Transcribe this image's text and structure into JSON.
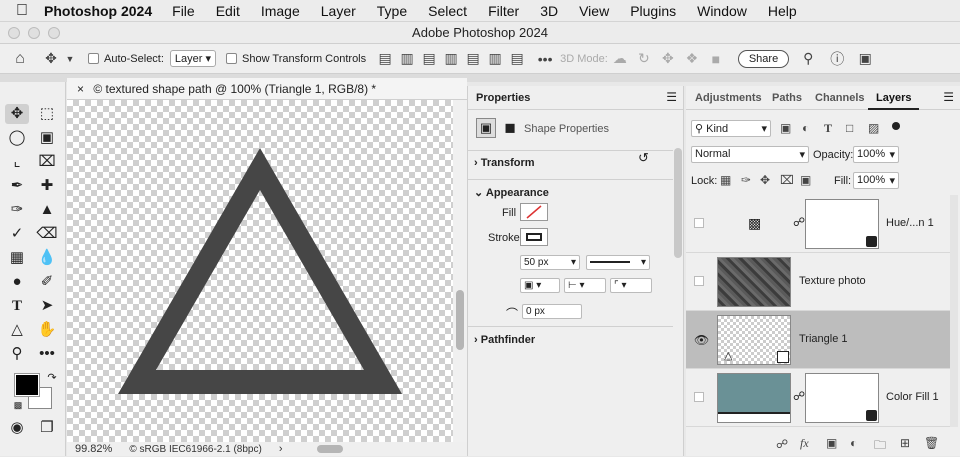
{
  "menubar": {
    "app": "Photoshop 2024",
    "items": [
      "File",
      "Edit",
      "Image",
      "Layer",
      "Type",
      "Select",
      "Filter",
      "3D",
      "View",
      "Plugins",
      "Window",
      "Help"
    ]
  },
  "window": {
    "title": "Adobe Photoshop 2024"
  },
  "options": {
    "auto_select_label": "Auto-Select:",
    "auto_select_value": "Layer",
    "show_transform_label": "Show Transform Controls",
    "mode_3d_label": "3D Mode:",
    "share_label": "Share"
  },
  "document": {
    "tab_title": "textured shape path @ 100% (Triangle 1, RGB/8) *",
    "zoom": "99.82%",
    "color_profile": "sRGB IEC61966-2.1 (8bpc)"
  },
  "properties": {
    "title": "Properties",
    "subtitle": "Shape Properties",
    "sections": {
      "transform": "Transform",
      "appearance": "Appearance",
      "pathfinder": "Pathfinder"
    },
    "fill_label": "Fill",
    "stroke_label": "Stroke",
    "stroke_width": "50 px",
    "corner_radius": "0 px"
  },
  "layers_panel": {
    "tabs": [
      "Adjustments",
      "Paths",
      "Channels",
      "Layers"
    ],
    "active_tab": "Layers",
    "kind_label": "Kind",
    "blend_mode": "Normal",
    "opacity_label": "Opacity:",
    "opacity_value": "100%",
    "lock_label": "Lock:",
    "fill_label": "Fill:",
    "fill_value": "100%",
    "layers": [
      {
        "name": "Hue/...n 1",
        "visible": false
      },
      {
        "name": "Texture photo",
        "visible": false
      },
      {
        "name": "Triangle 1",
        "visible": true,
        "selected": true
      },
      {
        "name": "Color Fill 1",
        "visible": false
      }
    ],
    "fill_color": "#6a9196"
  },
  "colors": {
    "triangle": "#464646",
    "selected_row": "#bdbdbd"
  }
}
